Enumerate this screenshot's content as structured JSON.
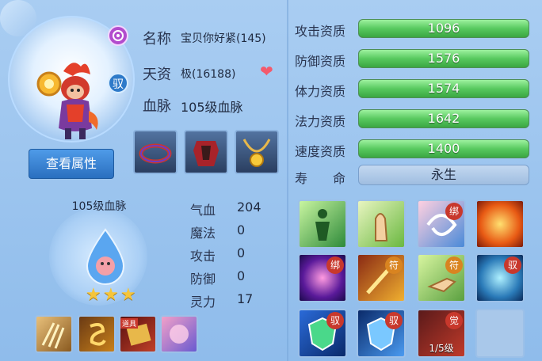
{
  "pet": {
    "name_label": "名称",
    "name_value": "宝贝你好紧(145)",
    "aptitude_label": "天资",
    "aptitude_value": "极(16188)",
    "bloodline_label": "血脉",
    "bloodline_value": "105级血脉",
    "bind_badge": "驭",
    "view_attributes_button": "查看属性"
  },
  "bloodline_panel": {
    "title": "105级血脉",
    "stars": 3,
    "star_glyph": "★"
  },
  "stats": [
    {
      "label": "气血",
      "value": "204"
    },
    {
      "label": "魔法",
      "value": "0"
    },
    {
      "label": "攻击",
      "value": "0"
    },
    {
      "label": "防御",
      "value": "0"
    },
    {
      "label": "灵力",
      "value": "17"
    }
  ],
  "aptitudes": [
    {
      "label": "攻击资质",
      "value": "1096",
      "fill": 1.0
    },
    {
      "label": "防御资质",
      "value": "1576",
      "fill": 1.0
    },
    {
      "label": "体力资质",
      "value": "1574",
      "fill": 1.0
    },
    {
      "label": "法力资质",
      "value": "1642",
      "fill": 1.0
    },
    {
      "label": "速度资质",
      "value": "1400",
      "fill": 1.0
    }
  ],
  "lifespan": {
    "label": "寿　　命",
    "value": "永生"
  },
  "small_skills": [
    {
      "icon": "claw-strike-icon",
      "tag": ""
    },
    {
      "icon": "golden-symbol-icon",
      "tag": ""
    },
    {
      "icon": "scroll-icon",
      "tag": "道具"
    },
    {
      "icon": "pink-aura-icon",
      "tag": ""
    }
  ],
  "skills": [
    {
      "icon": "green-silhouette-icon",
      "tag": "",
      "tag_color": "",
      "level": ""
    },
    {
      "icon": "praying-hand-icon",
      "tag": "",
      "tag_color": "",
      "level": ""
    },
    {
      "icon": "swirl-icon",
      "tag": "绑",
      "tag_color": "red",
      "level": ""
    },
    {
      "icon": "fireball-icon",
      "tag": "",
      "tag_color": "",
      "level": ""
    },
    {
      "icon": "vortex-icon",
      "tag": "绑",
      "tag_color": "red",
      "level": ""
    },
    {
      "icon": "sword-strike-icon",
      "tag": "符",
      "tag_color": "orange",
      "level": ""
    },
    {
      "icon": "pointing-hand-icon",
      "tag": "符",
      "tag_color": "orange",
      "level": ""
    },
    {
      "icon": "lion-spirit-icon",
      "tag": "驭",
      "tag_color": "red",
      "level": ""
    },
    {
      "icon": "green-shield-icon",
      "tag": "驭",
      "tag_color": "red",
      "level": ""
    },
    {
      "icon": "blue-shield-icon",
      "tag": "驭",
      "tag_color": "red",
      "level": ""
    },
    {
      "icon": "awaken-icon",
      "tag": "觉",
      "tag_color": "red",
      "level": "1/5级"
    },
    {
      "icon": "empty-slot",
      "tag": "",
      "tag_color": "",
      "level": ""
    }
  ]
}
